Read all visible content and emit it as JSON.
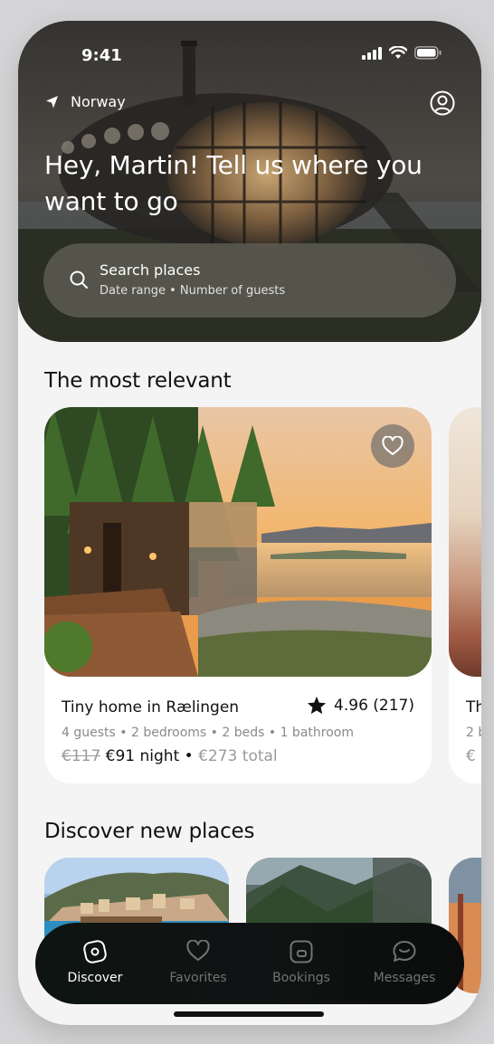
{
  "status": {
    "time": "9:41"
  },
  "header": {
    "location": "Norway",
    "title": "Hey, Martin! Tell us where you want to go"
  },
  "search": {
    "title": "Search places",
    "subtitle": "Date range • Number of guests"
  },
  "sections": {
    "relevant": "The most relevant",
    "discover": "Discover new places"
  },
  "listing": {
    "name": "Tiny home in Rælingen",
    "rating": "4.96 (217)",
    "details": "4 guests • 2 bedrooms • 2 beds • 1 bathroom",
    "old_price": "€117",
    "price": "€91 night",
    "separator": " • ",
    "total": "€273 total"
  },
  "listing_peek": {
    "name": "Th",
    "details": "2 b",
    "price": "€"
  },
  "tabs": [
    {
      "label": "Discover",
      "icon": "compass-icon",
      "active": true
    },
    {
      "label": "Favorites",
      "icon": "heart-icon",
      "active": false
    },
    {
      "label": "Bookings",
      "icon": "bookings-icon",
      "active": false
    },
    {
      "label": "Messages",
      "icon": "messages-icon",
      "active": false
    }
  ],
  "colors": {
    "background": "#f4f4f5",
    "tabbar": "#0f1312",
    "text": "#111111",
    "muted": "#8a8a8a"
  }
}
